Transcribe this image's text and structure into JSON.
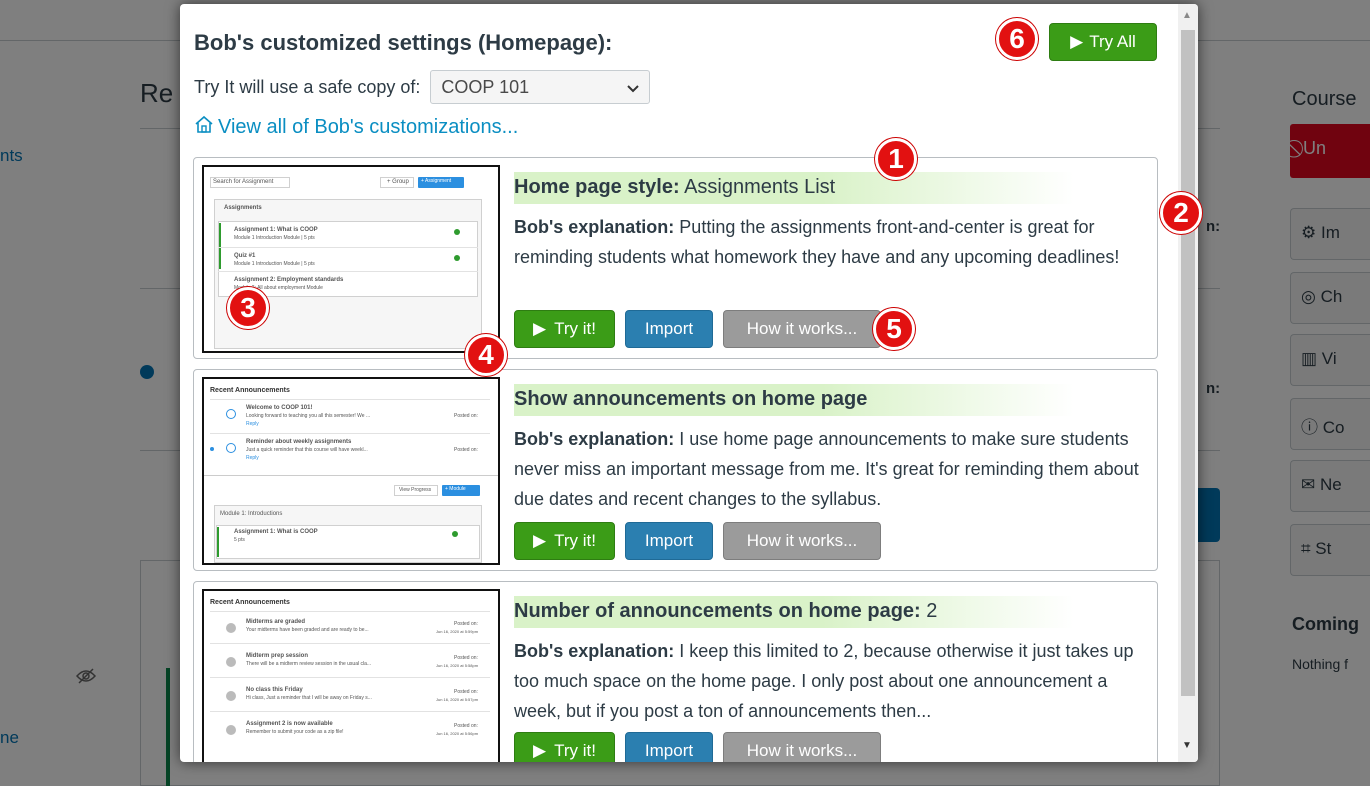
{
  "background": {
    "title_fragment": "Re",
    "left_links": [
      "nts",
      "ne"
    ],
    "right": {
      "title": "Course",
      "unpublish_btn": "Un",
      "side_buttons": [
        "Im",
        "Ch",
        "Vi",
        "Co",
        "Ne",
        "St"
      ],
      "coming_up": "Coming",
      "nothing": "Nothing f",
      "n_labels": [
        "n:",
        "n:"
      ]
    }
  },
  "dialog": {
    "title": "Bob's customized settings (Homepage):",
    "try_all_label": "Try All",
    "copy_label": "Try It will use a safe copy of:",
    "copy_select_value": "COOP 101",
    "view_all_link": "View all of Bob's customizations..."
  },
  "cards": [
    {
      "title_bold": "Home page style:",
      "title_rest": " Assignments List",
      "explanation_label": "Bob's explanation:",
      "explanation": " Putting the assignments front-and-center is great for reminding students what homework they have and any upcoming deadlines!",
      "try_label": "Try it!",
      "import_label": "Import",
      "how_label": "How it works..."
    },
    {
      "title_bold": "Show announcements on home page",
      "title_rest": "",
      "explanation_label": "Bob's explanation:",
      "explanation": " I use home page announcements to make sure students never miss an important message from me. It's great for reminding them about due dates and recent changes to the syllabus.",
      "try_label": "Try it!",
      "import_label": "Import",
      "how_label": "How it works..."
    },
    {
      "title_bold": "Number of announcements on home page:",
      "title_rest": " 2",
      "explanation_label": "Bob's explanation:",
      "explanation": " I keep this limited to 2, because otherwise it just takes up too much space on the home page. I only post about one announcement a week, but if you post a ton of announcements then...",
      "try_label": "Try it!",
      "import_label": "Import",
      "how_label": "How it works..."
    }
  ],
  "badges": [
    "1",
    "2",
    "3",
    "4",
    "5",
    "6"
  ],
  "thumb1": {
    "search": "Search for Assignment",
    "group_btn": "+ Group",
    "assign_btn": "+ Assignment",
    "section": "Assignments",
    "items": [
      {
        "name": "Assignment 1: What is COOP",
        "meta": "Module 1 Introduction Module | 5 pts"
      },
      {
        "name": "Quiz #1",
        "meta": "Module 1 Introduction Module | 5 pts"
      },
      {
        "name": "Assignment 2: Employment standards",
        "meta": "Module 2: All about employment Module"
      }
    ]
  },
  "thumb2": {
    "header": "Recent Announcements",
    "items": [
      {
        "title": "Welcome to COOP 101!",
        "text": "Looking forward to teaching you all this semester! We ...",
        "reply": "Reply",
        "posted": "Posted on:"
      },
      {
        "title": "Reminder about weekly assignments",
        "text": "Just a quick reminder that this course will have weekl...",
        "reply": "Reply",
        "posted": "Posted on:"
      }
    ],
    "view_progress": "View Progress",
    "module_btn": "+ Module",
    "module_section": "Module 1: Introductions",
    "module_item": "Assignment 1: What is COOP",
    "module_meta": "5 pts"
  },
  "thumb3": {
    "header": "Recent Announcements",
    "items": [
      {
        "title": "Midterms are graded",
        "text": "Your midterms have been graded and are ready to be...",
        "posted": "Posted on:",
        "date": "Jun 16, 2020 at 5:59pm"
      },
      {
        "title": "Midterm prep session",
        "text": "There will be a midterm review session in the usual cla...",
        "posted": "Posted on:",
        "date": "Jun 16, 2020 at 5:58pm"
      },
      {
        "title": "No class this Friday",
        "text": "Hi class, Just a reminder that I will be away on Friday s...",
        "posted": "Posted on:",
        "date": "Jun 16, 2020 at 5:57pm"
      },
      {
        "title": "Assignment 2 is now available",
        "text": "Remember to submit your code as a zip file!",
        "posted": "Posted on:",
        "date": "Jun 16, 2020 at 5:56pm"
      }
    ]
  },
  "colors": {
    "green": "#3b9c17",
    "blue": "#2b7fb0",
    "gray": "#9b9b9b",
    "link": "#0a8ec2",
    "badge_red": "#e21111"
  }
}
